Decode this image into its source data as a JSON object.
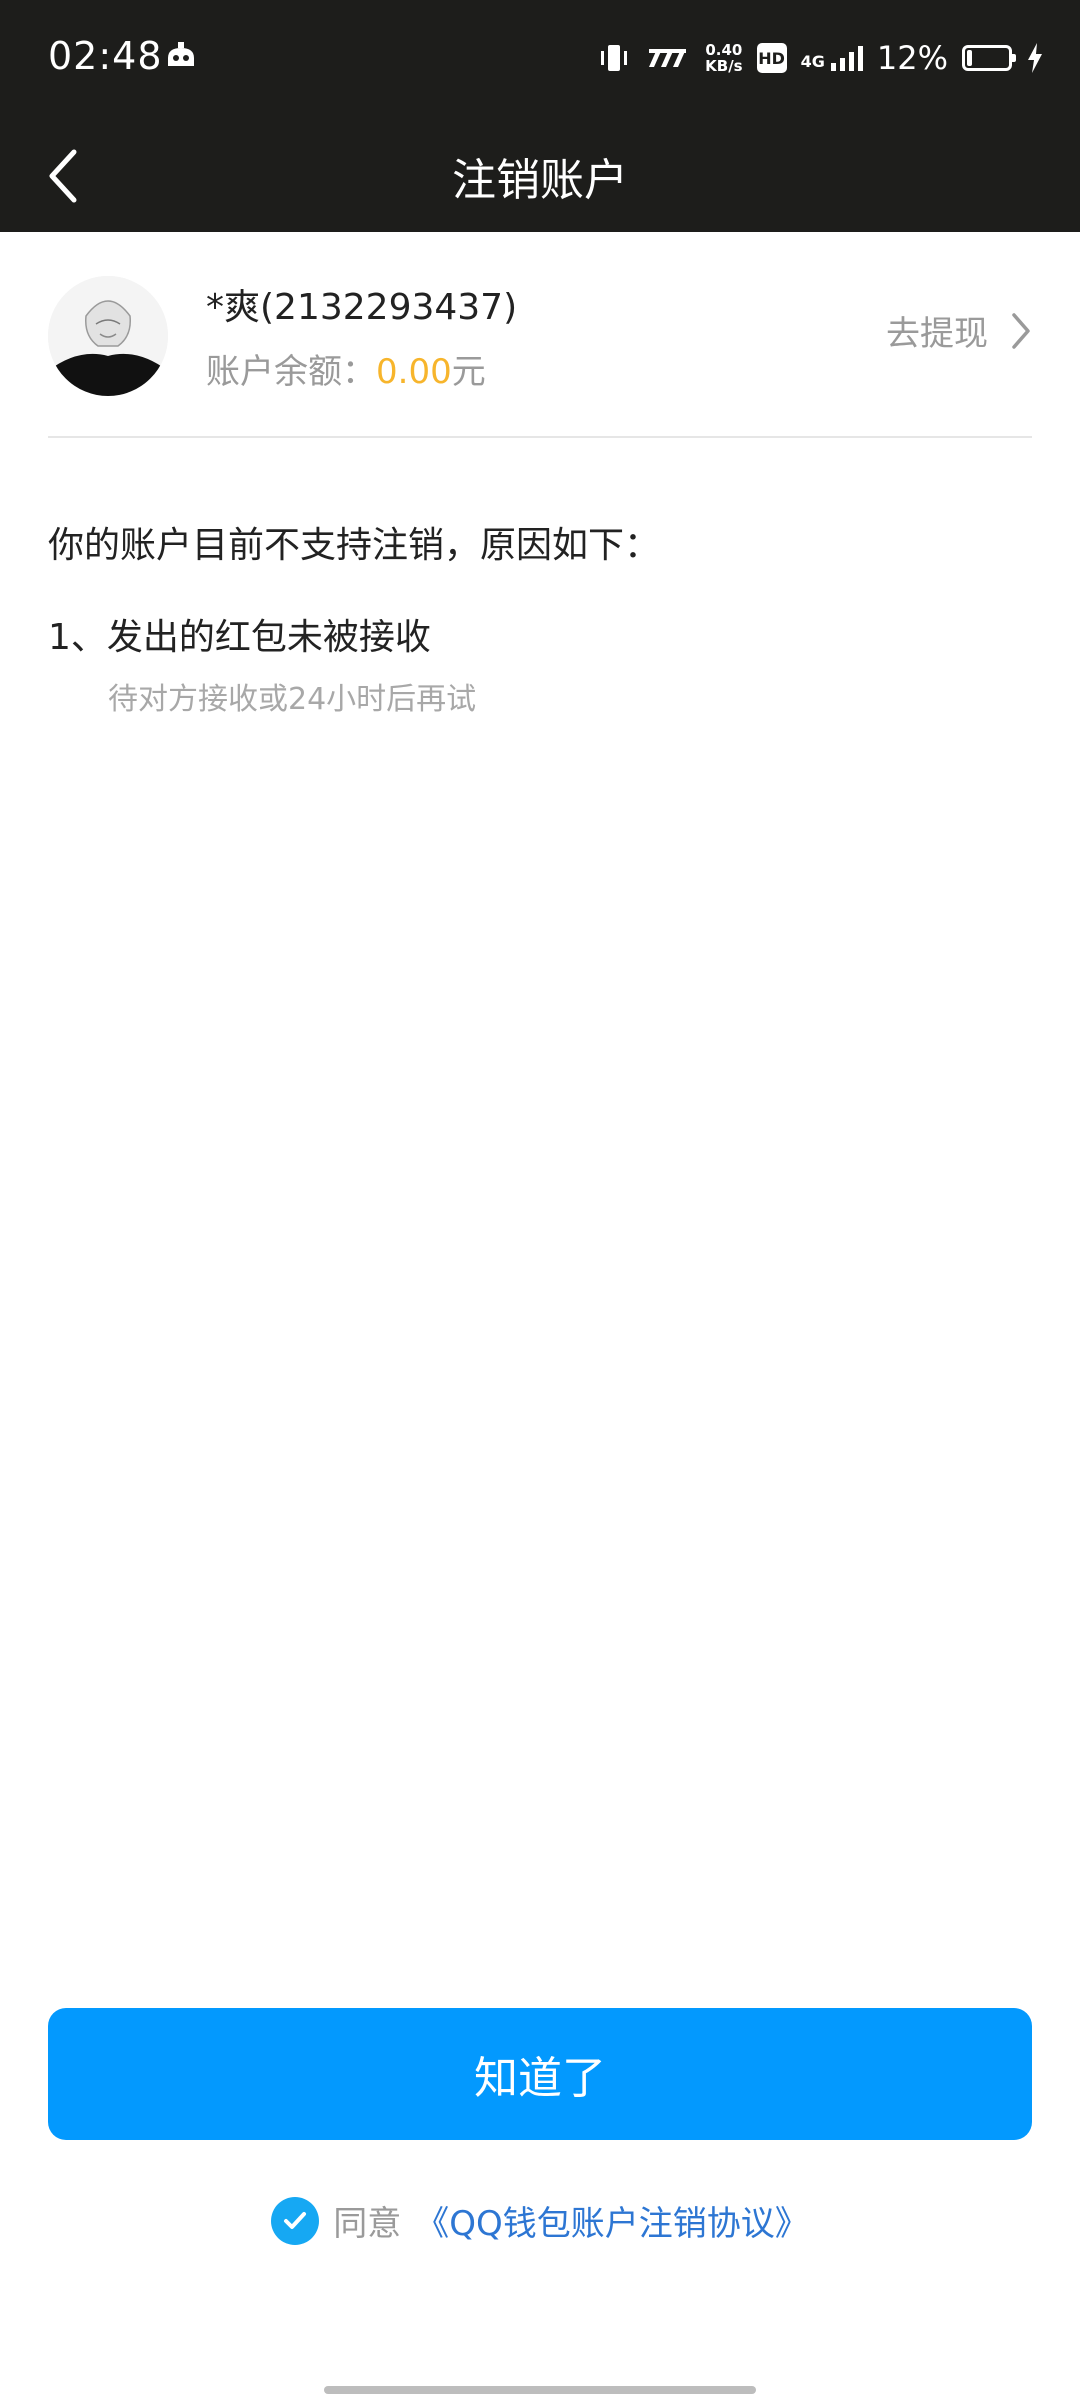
{
  "status_bar": {
    "time": "02:48",
    "notification_icon": "game-app-icon",
    "vibrate_icon": "vibrate-icon",
    "speed_icon": "network-activity-icon",
    "net_speed_value": "0.40",
    "net_speed_unit": "KB/s",
    "hd_label": "HD",
    "signal_label": "4G",
    "battery_percent": "12%",
    "battery_level": 0.12,
    "charging_icon": "charging-bolt-icon"
  },
  "nav": {
    "title": "注销账户",
    "back_icon": "chevron-left-icon"
  },
  "account": {
    "name": "*爽(2132293437)",
    "balance_label": "账户余额：",
    "balance_amount": "0.00",
    "balance_unit": "元",
    "withdraw_label": "去提现",
    "withdraw_icon": "chevron-right-icon"
  },
  "reasons": {
    "intro": "你的账户目前不支持注销，原因如下：",
    "items": [
      {
        "title": "1、发出的红包未被接收",
        "detail": "待对方接收或24小时后再试"
      }
    ]
  },
  "actions": {
    "confirm_label": "知道了",
    "agree_prefix": "同意",
    "agreement_link": "《QQ钱包账户注销协议》",
    "check_icon": "check-circle-icon"
  },
  "colors": {
    "header_bg": "#1d1d1b",
    "primary_button": "#0399fe",
    "balance_amount": "#f7b52c",
    "link": "#2d76d3",
    "check": "#16a8f3"
  }
}
